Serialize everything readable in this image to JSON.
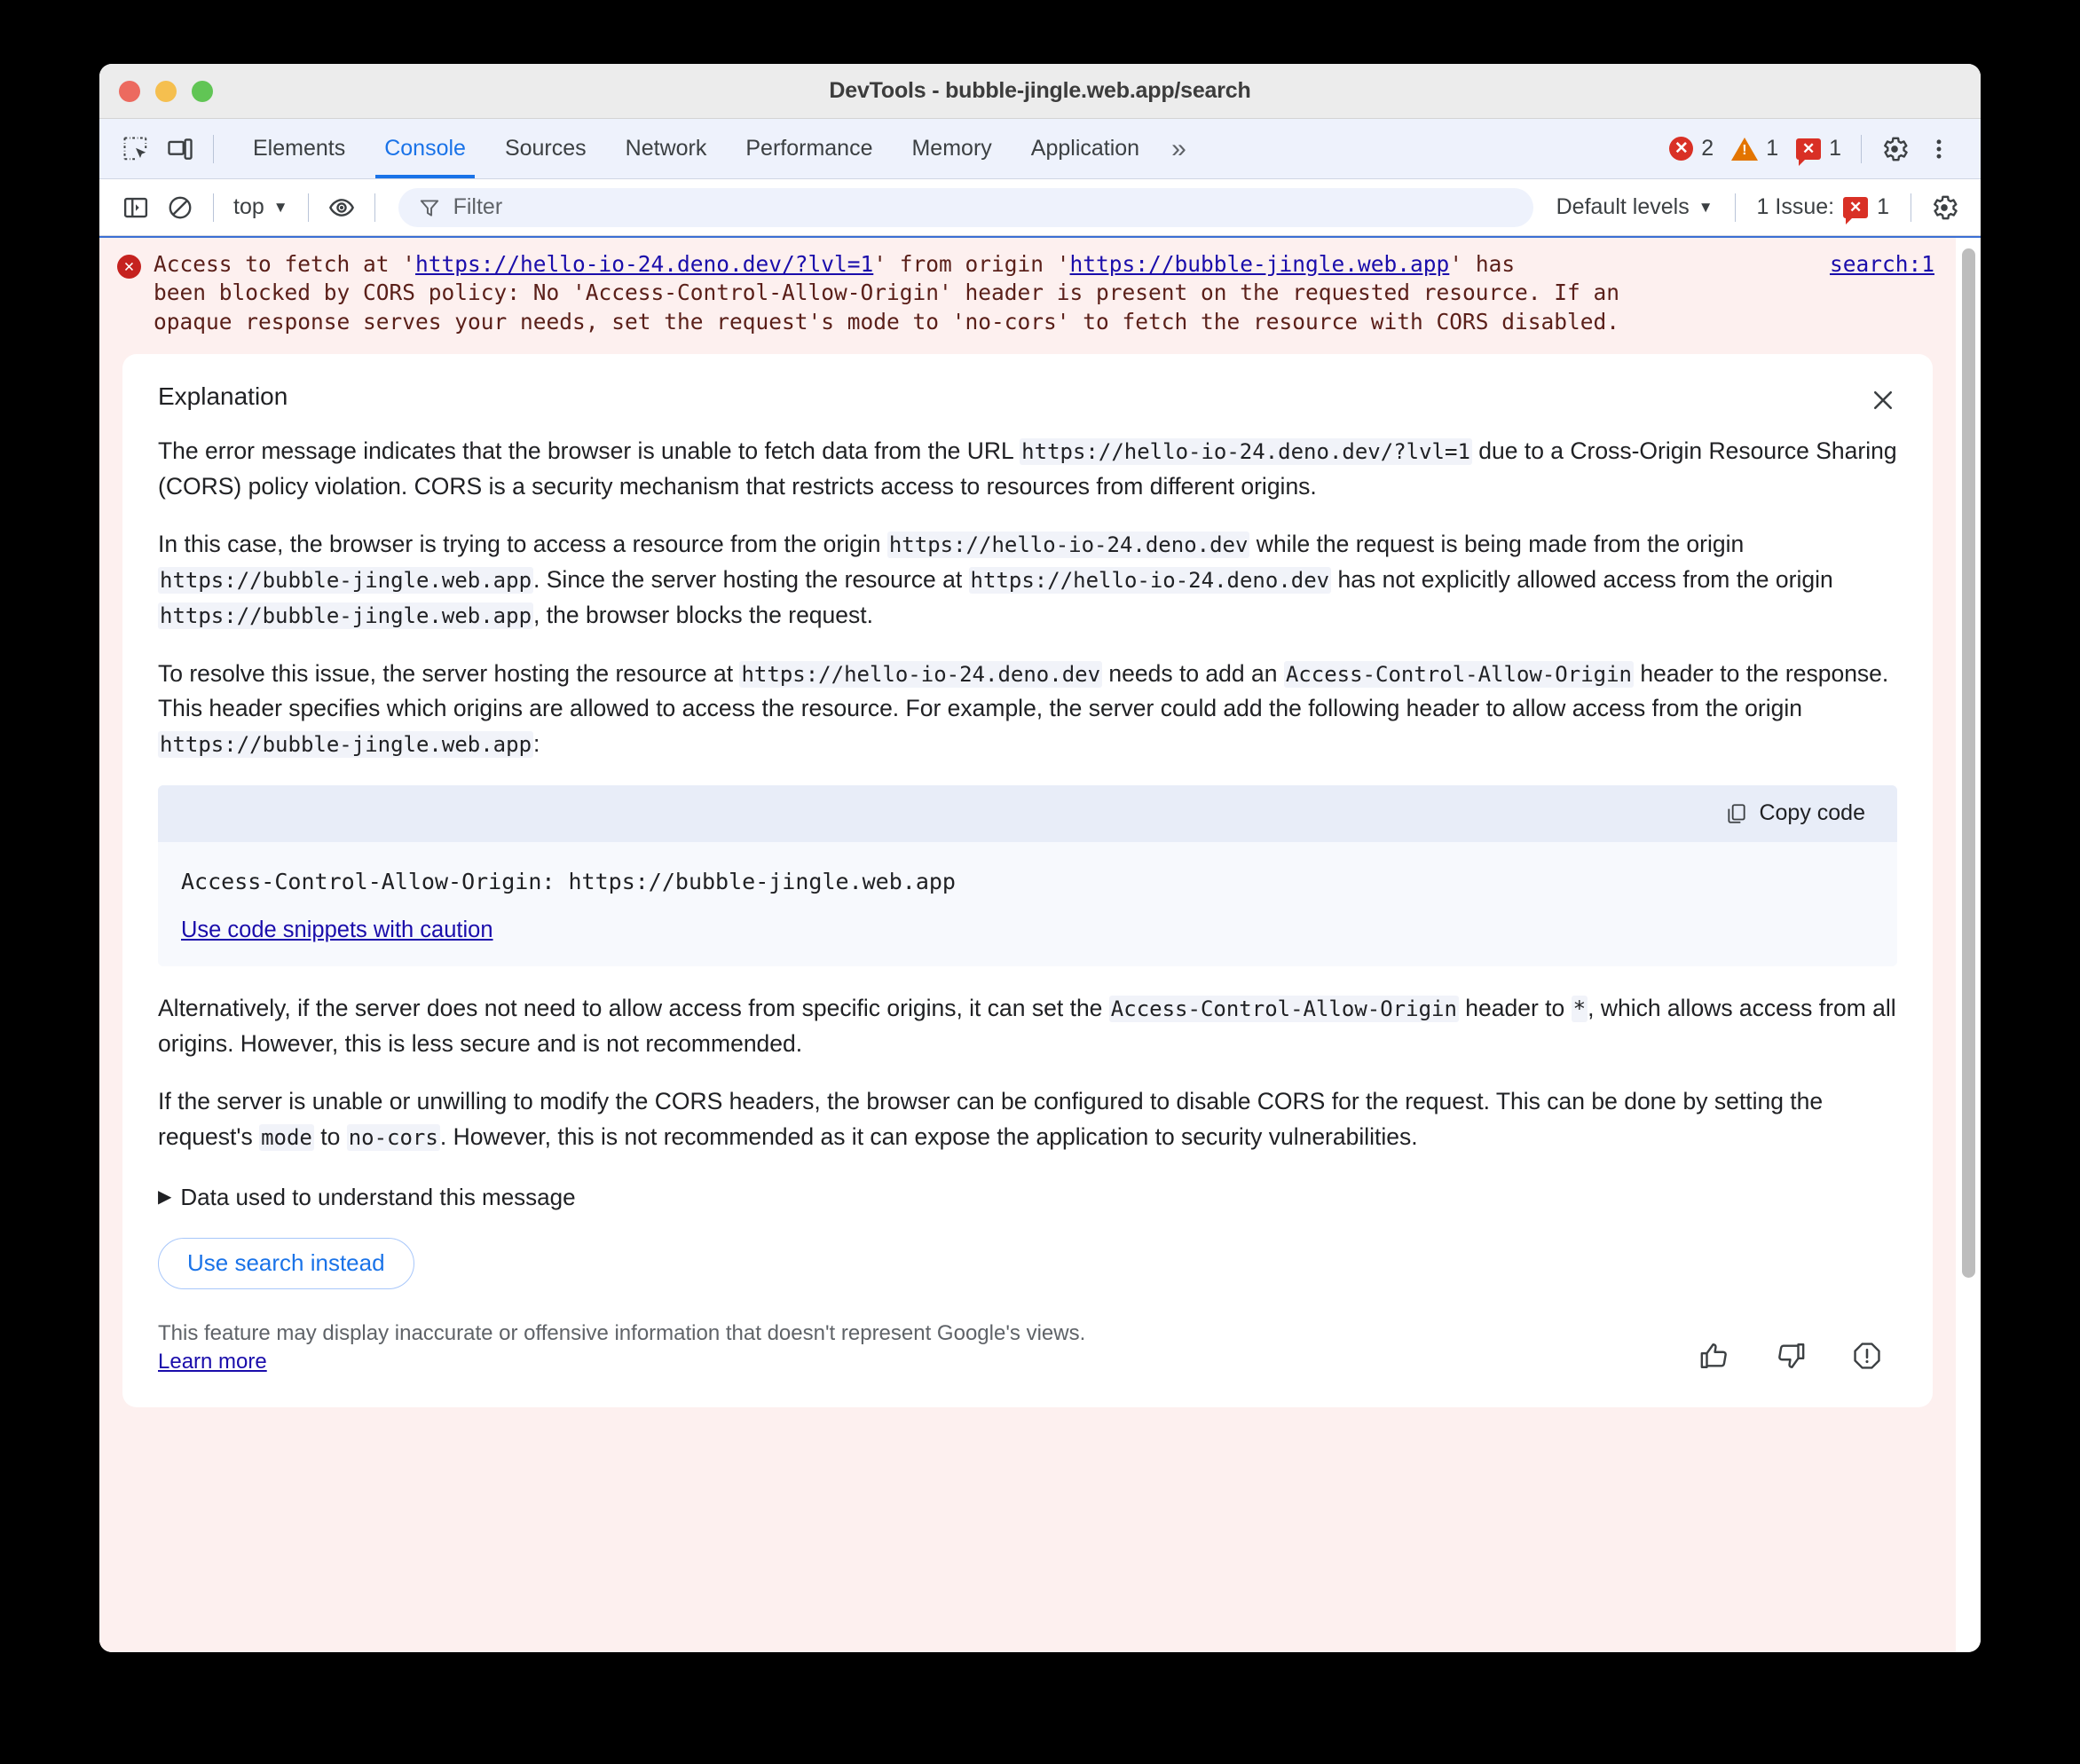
{
  "window": {
    "title": "DevTools - bubble-jingle.web.app/search",
    "traffic_lights": [
      "close",
      "minimize",
      "zoom"
    ]
  },
  "tabbar": {
    "inspect_icon": "inspect-element-icon",
    "device_icon": "device-toolbar-icon",
    "tabs": [
      {
        "label": "Elements",
        "active": false
      },
      {
        "label": "Console",
        "active": true
      },
      {
        "label": "Sources",
        "active": false
      },
      {
        "label": "Network",
        "active": false
      },
      {
        "label": "Performance",
        "active": false
      },
      {
        "label": "Memory",
        "active": false
      },
      {
        "label": "Application",
        "active": false
      }
    ],
    "more_tabs": "»",
    "error_count": "2",
    "warning_count": "1",
    "issue_count": "1",
    "settings_icon": "gear-icon",
    "more_icon": "kebab-menu-icon"
  },
  "console_toolbar": {
    "sidebar_icon": "console-sidebar-icon",
    "clear_icon": "clear-console-icon",
    "context": "top",
    "eye_icon": "live-expression-icon",
    "filter_placeholder": "Filter",
    "filter_value": "",
    "levels": "Default levels",
    "issues_label": "1 Issue:",
    "issues_badge": "1",
    "settings_icon": "console-settings-gear-icon"
  },
  "console_message": {
    "icon": "error-icon",
    "line1_a": "Access to fetch at '",
    "link1": "https://hello-io-24.deno.dev/?lvl=1",
    "line1_b": "' from origin '",
    "link2": "https://bubble-jingle.web.app",
    "line1_c": "' has",
    "line2": "been blocked by CORS policy: No 'Access-Control-Allow-Origin' header is present on the requested resource. If an",
    "line3": "opaque response serves your needs, set the request's mode to 'no-cors' to fetch the resource with CORS disabled.",
    "source_link": "search:1"
  },
  "explanation": {
    "title": "Explanation",
    "close_icon": "close-icon",
    "p1": {
      "t1": "The error message indicates that the browser is unable to fetch data from the URL ",
      "c1": "https://hello-io-24.deno.dev/?lvl=1",
      "t2": " due to a Cross-Origin Resource Sharing (CORS) policy violation. CORS is a security mechanism that restricts access to resources from different origins."
    },
    "p2": {
      "t1": "In this case, the browser is trying to access a resource from the origin ",
      "c1": "https://hello-io-24.deno.dev",
      "t2": " while the request is being made from the origin ",
      "c2": "https://bubble-jingle.web.app",
      "t3": ". Since the server hosting the resource at ",
      "c3": "https://hello-io-24.deno.dev",
      "t4": " has not explicitly allowed access from the origin ",
      "c4": "https://bubble-jingle.web.app",
      "t5": ", the browser blocks the request."
    },
    "p3": {
      "t1": "To resolve this issue, the server hosting the resource at ",
      "c1": "https://hello-io-24.deno.dev",
      "t2": " needs to add an ",
      "c2": "Access-Control-Allow-Origin",
      "t3": " header to the response. This header specifies which origins are allowed to access the resource. For example, the server could add the following header to allow access from the origin ",
      "c3": "https://bubble-jingle.web.app",
      "t4": ":"
    },
    "codeblock": {
      "copy_label": "Copy code",
      "copy_icon": "copy-icon",
      "code": "Access-Control-Allow-Origin: https://bubble-jingle.web.app",
      "caution_link": "Use code snippets with caution"
    },
    "p4": {
      "t1": "Alternatively, if the server does not need to allow access from specific origins, it can set the ",
      "c1": "Access-Control-Allow-Origin",
      "t2": " header to ",
      "c2": "*",
      "t3": ", which allows access from all origins. However, this is less secure and is not recommended."
    },
    "p5": {
      "t1": "If the server is unable or unwilling to modify the CORS headers, the browser can be configured to disable CORS for the request. This can be done by setting the request's ",
      "c1": "mode",
      "t2": " to ",
      "c2": "no-cors",
      "t3": ". However, this is not recommended as it can expose the application to security vulnerabilities."
    },
    "disclosure_label": "Data used to understand this message",
    "disclosure_triangle": "▶",
    "search_button": "Use search instead",
    "disclaimer_text": "This feature may display inaccurate or offensive information that doesn't represent Google's views. ",
    "disclaimer_link": "Learn more",
    "thumbs_up_icon": "thumb-up-icon",
    "thumbs_down_icon": "thumb-down-icon",
    "report_icon": "report-icon"
  },
  "colors": {
    "accent": "#1a73e8",
    "error": "#d93025",
    "warning": "#e37400",
    "link": "#1a0dab",
    "error_bg": "#fdf0ef"
  }
}
